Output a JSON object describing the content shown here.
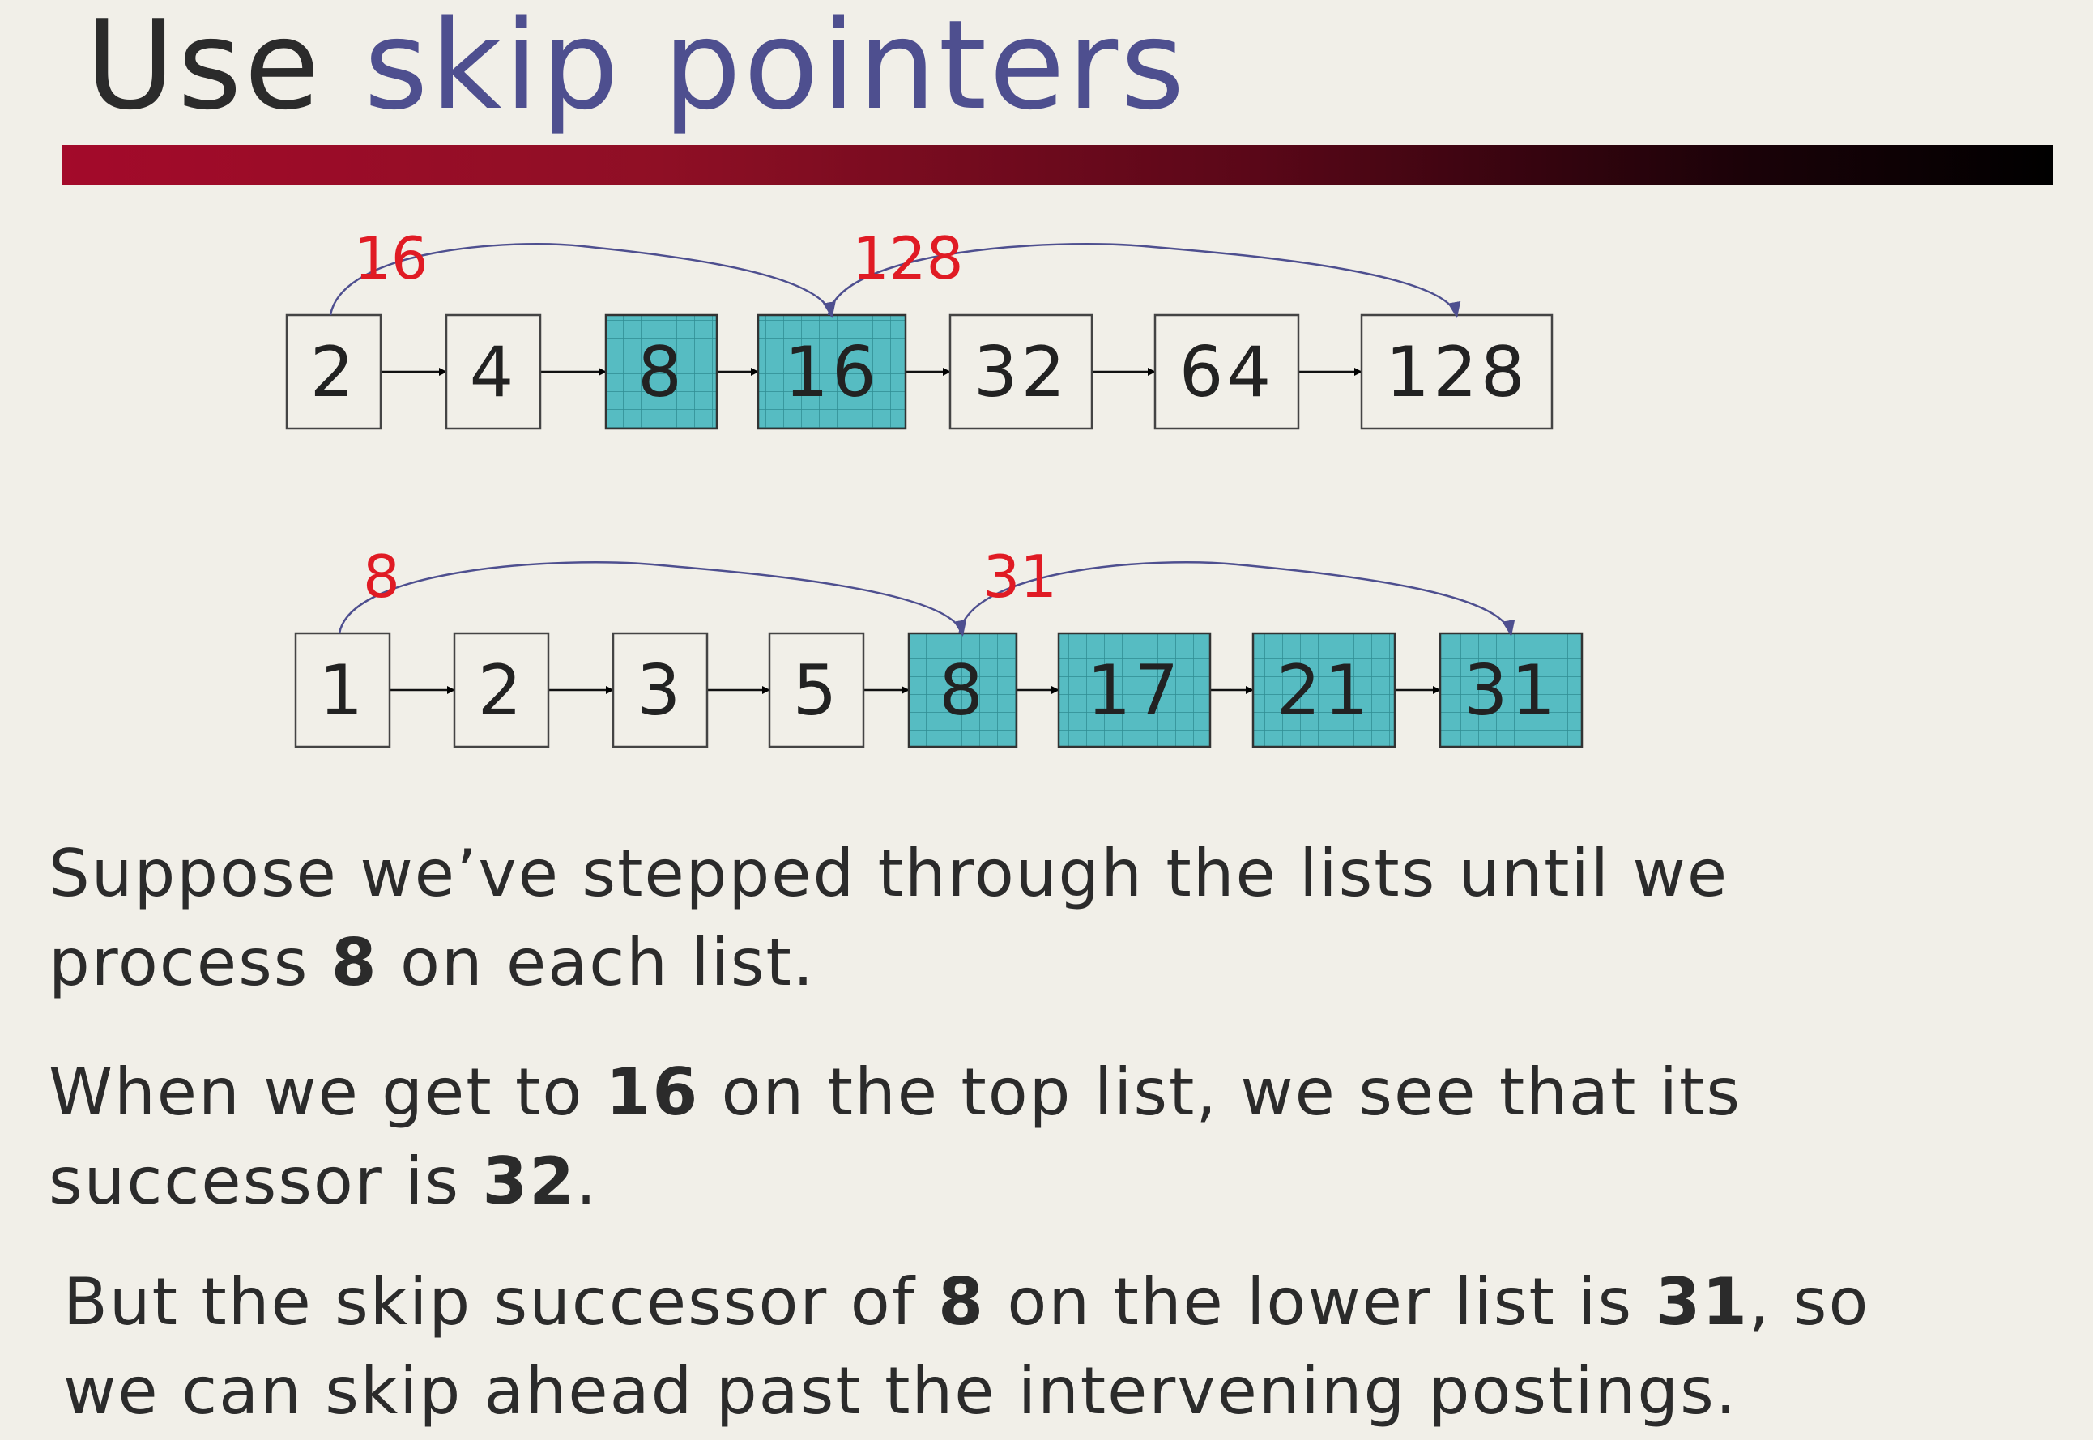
{
  "title": {
    "part1": "Use ",
    "part2": "skip pointers"
  },
  "colors": {
    "accent": "#4e4f8f",
    "highlight": "#56bcc2",
    "skip_label": "#e01b24"
  },
  "lists": [
    {
      "items": [
        "2",
        "4",
        "8",
        "16",
        "32",
        "64",
        "128"
      ],
      "highlighted": [
        false,
        false,
        true,
        true,
        false,
        false,
        false
      ],
      "skips": [
        {
          "from": "2",
          "to": "16",
          "label": "16"
        },
        {
          "from": "16",
          "to": "128",
          "label": "128"
        }
      ]
    },
    {
      "items": [
        "1",
        "2",
        "3",
        "5",
        "8",
        "17",
        "21",
        "31"
      ],
      "highlighted": [
        false,
        false,
        false,
        false,
        true,
        true,
        true,
        true
      ],
      "skips": [
        {
          "from": "1",
          "to": "8",
          "label": "8"
        },
        {
          "from": "8",
          "to": "31",
          "label": "31"
        }
      ]
    }
  ],
  "paragraphs": [
    {
      "runs": [
        {
          "t": "Suppose we’ve stepped through the lists until we"
        },
        {
          "br": true
        },
        {
          "t": "process "
        },
        {
          "t": "8",
          "b": true
        },
        {
          "t": " on each list."
        }
      ]
    },
    {
      "runs": [
        {
          "t": "When we get to "
        },
        {
          "t": "16",
          "b": true
        },
        {
          "t": " on the top list, we see that its"
        },
        {
          "br": true
        },
        {
          "t": "successor is "
        },
        {
          "t": "32",
          "b": true
        },
        {
          "t": "."
        }
      ]
    },
    {
      "runs": [
        {
          "t": "But the skip successor of "
        },
        {
          "t": "8",
          "b": true
        },
        {
          "t": " on the lower list is "
        },
        {
          "t": "31",
          "b": true
        },
        {
          "t": ", so"
        },
        {
          "br": true
        },
        {
          "t": "we can skip ahead past the intervening postings."
        }
      ]
    }
  ]
}
